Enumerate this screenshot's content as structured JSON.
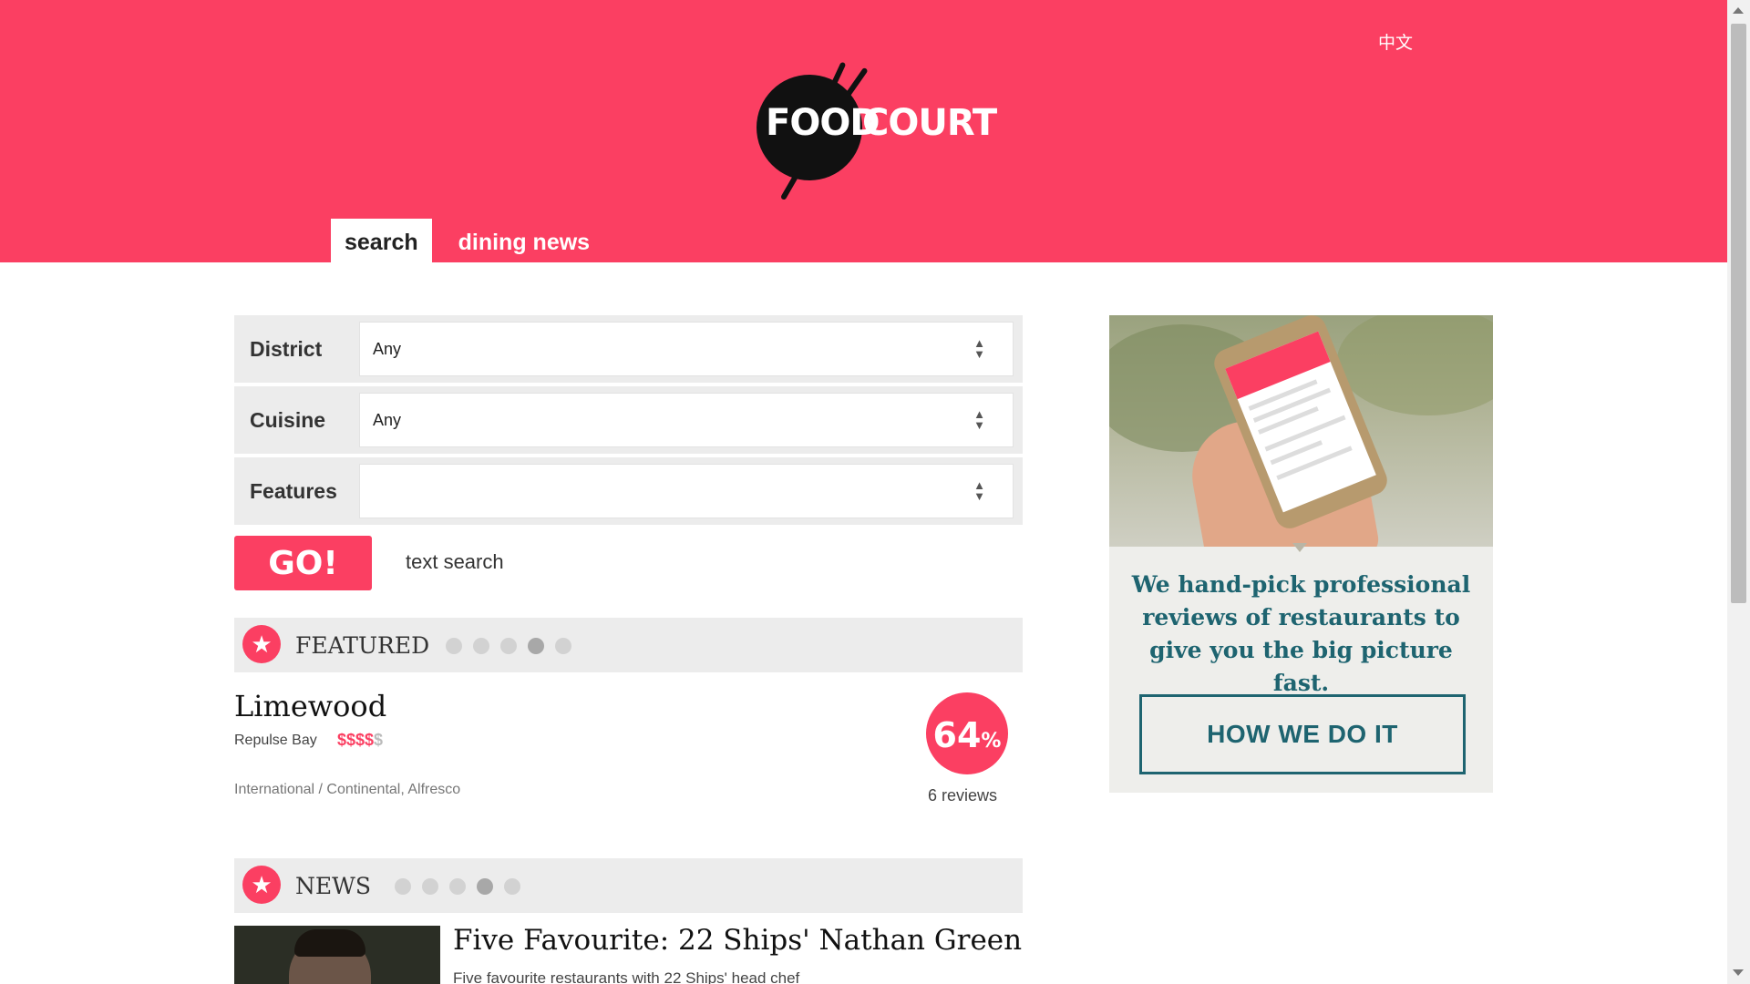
{
  "header": {
    "language_link": "中文",
    "logo": {
      "text_left": "FOOD",
      "text_right": "COURT"
    },
    "tabs": [
      {
        "label": "search",
        "active": true
      },
      {
        "label": "dining news",
        "active": false
      }
    ]
  },
  "search_form": {
    "fields": [
      {
        "label": "District",
        "value": "Any"
      },
      {
        "label": "Cuisine",
        "value": "Any"
      },
      {
        "label": "Features",
        "value": ""
      }
    ],
    "go_label": "GO!",
    "text_search_label": "text search"
  },
  "featured": {
    "section_title": "FEATURED",
    "slide_count": 5,
    "active_slide": 4,
    "restaurant": {
      "name": "Limewood",
      "district": "Repulse Bay",
      "price_active": "$$$$",
      "price_inactive": "$",
      "cuisine": "International / Continental, Alfresco",
      "score": "64",
      "score_unit": "%",
      "reviews": "6 reviews"
    }
  },
  "news": {
    "section_title": "NEWS",
    "slide_count": 5,
    "active_slide": 4,
    "article": {
      "title": "Five Favourite: 22 Ships' Nathan Green",
      "subtitle": "Five favourite restaurants with 22 Ships' head chef"
    }
  },
  "promo": {
    "tagline": "We hand-pick professional reviews of restaurants to give you the big picture fast.",
    "button_label": "HOW WE DO IT"
  },
  "colors": {
    "brand_pink": "#fb3f62",
    "teal": "#1e6470",
    "section_bg": "#ececec"
  }
}
